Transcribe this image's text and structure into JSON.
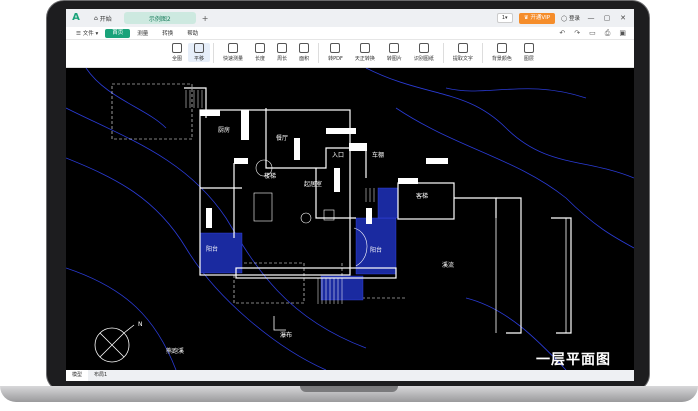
{
  "titlebar": {
    "home_tab": "开始",
    "file_tab": "示例图2",
    "plus": "+",
    "page_select": "1",
    "vip_label": "开通VIP",
    "login_label": "登录",
    "minimize": "—",
    "maximize": "▢",
    "close": "✕"
  },
  "menubar": {
    "items": [
      "文件",
      "首页",
      "测量",
      "转换",
      "帮助"
    ],
    "active": "首页",
    "dropdown_caret": "▾"
  },
  "toolbar": {
    "tools": [
      "全图",
      "平移",
      "快速测量",
      "长度",
      "周长",
      "面积",
      "转PDF",
      "天正转换",
      "转图片",
      "识别图纸",
      "提取文字",
      "背景颜色",
      "图层"
    ],
    "active": "平移"
  },
  "canvas": {
    "room_labels": {
      "kitchen": "厨房",
      "dining": "餐厅",
      "entrance": "入口",
      "garage": "车棚",
      "stairs": "楼梯",
      "living": "起居室",
      "guest": "客梯",
      "terrace_left": "阳台",
      "terrace_right": "阳台",
      "stream": "溪流",
      "waterfall": "瀑布",
      "brook": "熊跑溪"
    },
    "north_label": "N",
    "caption": "一层平面图",
    "colors": {
      "background": "#000000",
      "walls": "#ffffff",
      "contours": "#2a3bd6",
      "hatch": "#3b4cf0"
    }
  },
  "statusbar": {
    "tabs": [
      "模型",
      "布局1"
    ],
    "active": "模型"
  }
}
